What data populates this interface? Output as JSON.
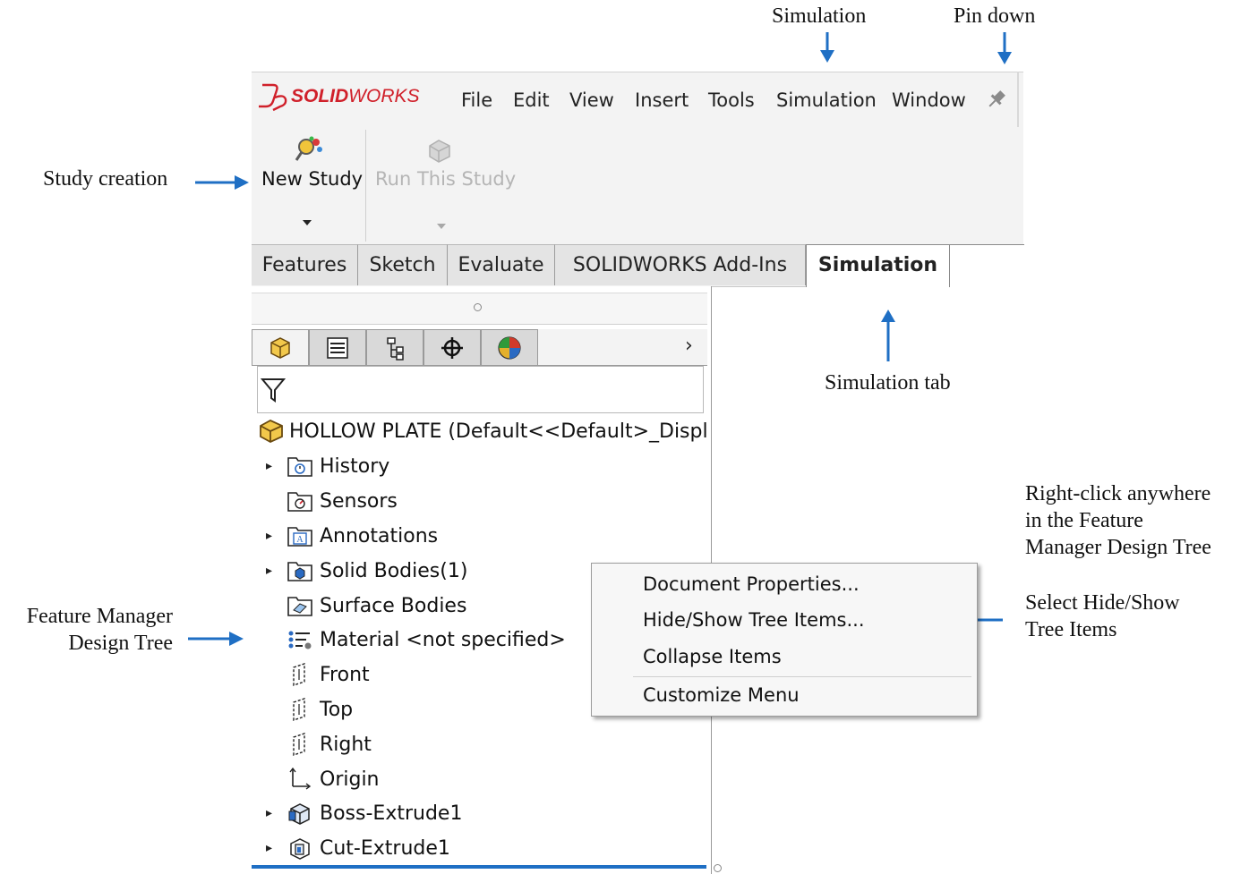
{
  "annotations": {
    "simulation_label": "Simulation",
    "pin_down_label": "Pin down",
    "study_creation": "Study creation",
    "simulation_tab": "Simulation tab",
    "right_click": [
      "Right-click anywhere",
      "in the Feature",
      "Manager Design Tree"
    ],
    "select_hide_show": [
      "Select Hide/Show",
      "Tree Items"
    ],
    "feature_manager": [
      "Feature Manager",
      "Design Tree"
    ],
    "arrow_color": "#1f6fc4"
  },
  "app": {
    "logo_ds": "DS",
    "logo_bold": "SOLID",
    "logo_light": "WORKS",
    "brand_color": "#d0202a"
  },
  "menu": [
    "File",
    "Edit",
    "View",
    "Insert",
    "Tools",
    "Simulation",
    "Window"
  ],
  "toolbar": {
    "new_study": "New Study",
    "run_study": "Run This Study"
  },
  "tabs": [
    "Features",
    "Sketch",
    "Evaluate",
    "SOLIDWORKS Add-Ins",
    "Simulation"
  ],
  "active_tab": "Simulation",
  "panel": {
    "root_label": "HOLLOW PLATE  (Default<<Default>_Displ",
    "tree": [
      {
        "label": "History",
        "icon": "history-folder-icon",
        "expandable": true
      },
      {
        "label": "Sensors",
        "icon": "sensors-folder-icon",
        "expandable": false
      },
      {
        "label": "Annotations",
        "icon": "annotations-folder-icon",
        "expandable": true
      },
      {
        "label": "Solid Bodies(1)",
        "icon": "solid-bodies-folder-icon",
        "expandable": true
      },
      {
        "label": "Surface Bodies",
        "icon": "surface-bodies-folder-icon",
        "expandable": false
      },
      {
        "label": "Material <not specified>",
        "icon": "material-icon",
        "expandable": false
      },
      {
        "label": "Front",
        "icon": "plane-icon",
        "expandable": false
      },
      {
        "label": "Top",
        "icon": "plane-icon",
        "expandable": false
      },
      {
        "label": "Right",
        "icon": "plane-icon",
        "expandable": false
      },
      {
        "label": "Origin",
        "icon": "origin-icon",
        "expandable": false
      },
      {
        "label": "Boss-Extrude1",
        "icon": "boss-extrude-icon",
        "expandable": true
      },
      {
        "label": "Cut-Extrude1",
        "icon": "cut-extrude-icon",
        "expandable": true
      }
    ]
  },
  "context_menu": [
    "Document Properties...",
    "Hide/Show Tree Items...",
    "Collapse Items",
    "Customize Menu"
  ]
}
